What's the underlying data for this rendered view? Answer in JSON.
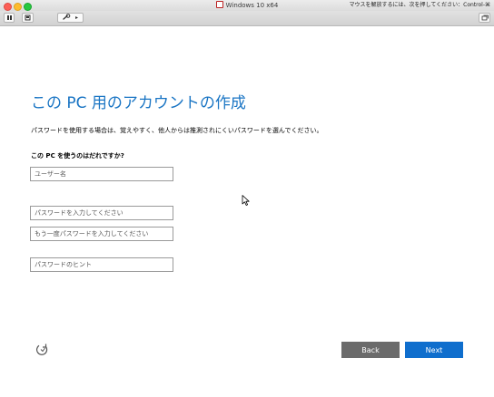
{
  "window": {
    "title": "Windows 10 x64",
    "release_hint": "マウスを解放するには、次を押してください：Control-⌘",
    "traffic_colors": {
      "close": "#fc5f57",
      "minimize": "#fdbc2e",
      "maximize": "#27c840"
    }
  },
  "toolbar": {
    "pause_icon": "pause-icon",
    "snapshot_icon": "snapshot-icon",
    "settings_icon": "wrench-icon",
    "settings_chevron": "▸",
    "window_icon": "restore-window-icon"
  },
  "setup": {
    "title": "この PC 用のアカウントの作成",
    "description": "パスワードを使用する場合は、覚えやすく、他人からは推測されにくいパスワードを選んでください。",
    "question": "この PC を使うのはだれですか?",
    "fields": {
      "username_placeholder": "ユーザー名",
      "password_placeholder": "パスワードを入力してください",
      "confirm_placeholder": "もう一度パスワードを入力してください",
      "hint_placeholder": "パスワードのヒント"
    },
    "back_label": "Back",
    "next_label": "Next",
    "colors": {
      "title": "#1a75c4",
      "next": "#0f6ecd",
      "back": "#6b6b6b"
    }
  }
}
